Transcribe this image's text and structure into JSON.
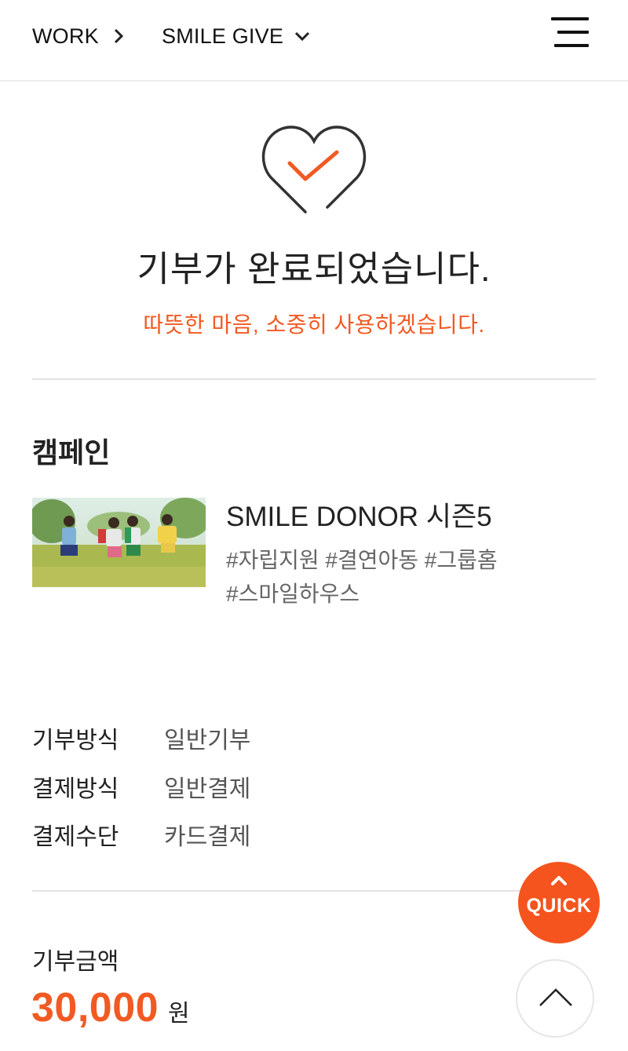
{
  "header": {
    "breadcrumb_1": "WORK",
    "breadcrumb_2": "SMILE GIVE"
  },
  "completion": {
    "title": "기부가 완료되었습니다.",
    "subtitle": "따뜻한 마음, 소중히 사용하겠습니다."
  },
  "campaign": {
    "section_title": "캠페인",
    "name": "SMILE DONOR 시즌5",
    "tags_line1": "#자립지원 #결연아동 #그룹홈",
    "tags_line2": "#스마일하우스"
  },
  "details": [
    {
      "label": "기부방식",
      "value": "일반기부"
    },
    {
      "label": "결제방식",
      "value": "일반결제"
    },
    {
      "label": "결제수단",
      "value": "카드결제"
    }
  ],
  "amount": {
    "label": "기부금액",
    "value": "30,000",
    "unit": "원"
  },
  "floating": {
    "quick_label": "QUICK"
  },
  "icons": {
    "breadcrumb_1": "chevron-right-icon",
    "breadcrumb_2": "chevron-down-icon",
    "menu": "hamburger-menu-icon",
    "completion": "heart-check-icon",
    "quick": "chevron-up-icon",
    "top": "arrow-up-icon"
  },
  "colors": {
    "accent": "#f15a22",
    "text": "#222222",
    "muted": "#666666"
  }
}
